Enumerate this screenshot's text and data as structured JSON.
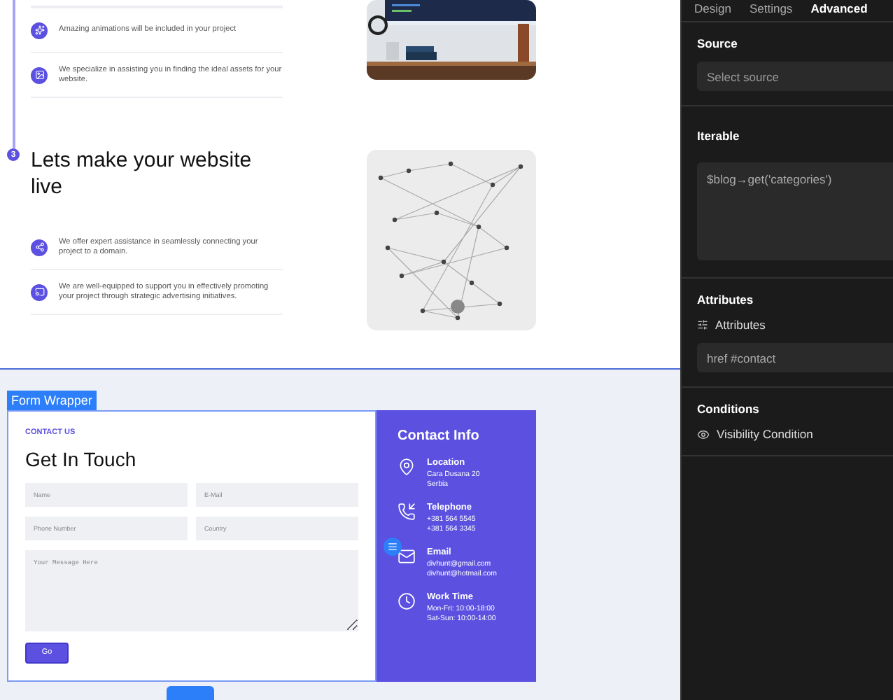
{
  "canvas": {
    "first_items": [
      {
        "text": "Amazing animations will be included in your project"
      },
      {
        "text": "We specialize in assisting you in finding the ideal assets for your website."
      }
    ],
    "step": {
      "number": "3",
      "heading": "Lets make your website live",
      "items": [
        {
          "text": "We offer expert assistance in seamlessly connecting your project to a domain."
        },
        {
          "text": "We are well-equipped to support you in effectively promoting your project through strategic advertising initiatives."
        }
      ]
    },
    "selection_label": "Form Wrapper",
    "form": {
      "eyebrow": "CONTACT US",
      "title": "Get In Touch",
      "fields": [
        {
          "placeholder": "Name"
        },
        {
          "placeholder": "E-Mail"
        },
        {
          "placeholder": "Phone Number"
        },
        {
          "placeholder": "Country"
        }
      ],
      "message": {
        "placeholder": "Your Message Here"
      },
      "submit": "Go"
    },
    "contact_info": {
      "title": "Contact Info",
      "items": [
        {
          "title": "Location",
          "lines": [
            "Cara Dusana 20",
            "Serbia"
          ]
        },
        {
          "title": "Telephone",
          "lines": [
            "+381 564 5545",
            "+381 564 3345"
          ]
        },
        {
          "title": "Email",
          "lines": [
            "divhunt@gmail.com",
            "divhunt@hotmail.com"
          ]
        },
        {
          "title": "Work Time",
          "lines": [
            "Mon-Fri: 10:00-18:00",
            "Sat-Sun: 10:00-14:00"
          ]
        }
      ]
    }
  },
  "panel": {
    "tabs": [
      {
        "label": "Design",
        "selected": false
      },
      {
        "label": "Settings",
        "selected": false
      },
      {
        "label": "Advanced",
        "selected": true
      }
    ],
    "source": {
      "title": "Source",
      "placeholder": "Select source"
    },
    "iterable": {
      "title": "Iterable",
      "value": "$blog→get('categories')"
    },
    "attributes": {
      "title": "Attributes",
      "row_label": "Attributes",
      "value": "href #contact"
    },
    "conditions": {
      "title": "Conditions",
      "row_label": "Visibility Condition"
    }
  }
}
